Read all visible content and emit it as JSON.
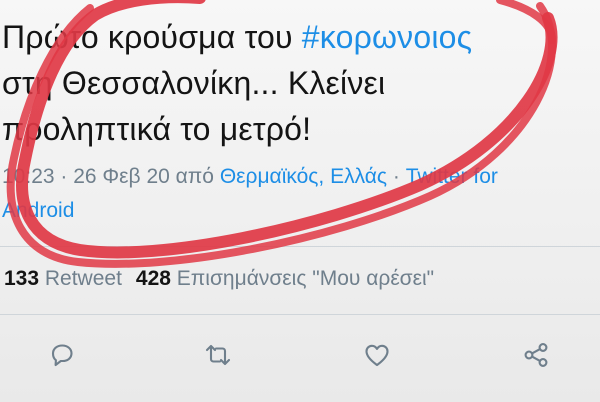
{
  "tweet": {
    "text_line1_prefix": "Πρώτο κρούσμα του ",
    "hashtag": "#κορωνοιος",
    "text_line2": "στη Θεσσαλονίκη... Κλείνει",
    "text_line3": "προληπτικά το μετρό!"
  },
  "meta": {
    "time": "10:23",
    "separator1": " · ",
    "date": "26 Φεβ 20",
    "from_word": " από ",
    "location": "Θερμαϊκός, Ελλάς",
    "separator2": " · ",
    "client_line1": "Twitter for",
    "client_line2": "Android"
  },
  "stats": {
    "retweets_count": "133",
    "retweets_label": " Retweet",
    "likes_count": "428",
    "likes_label": " Επισημάνσεις \"Μου αρέσει\""
  },
  "actions": {
    "reply_icon": "reply-icon",
    "retweet_icon": "retweet-icon",
    "like_icon": "like-icon",
    "share_icon": "share-icon"
  },
  "colors": {
    "link": "#1d8ee6",
    "muted": "#6f7f8c",
    "text": "#141414",
    "marker": "#e03845"
  }
}
